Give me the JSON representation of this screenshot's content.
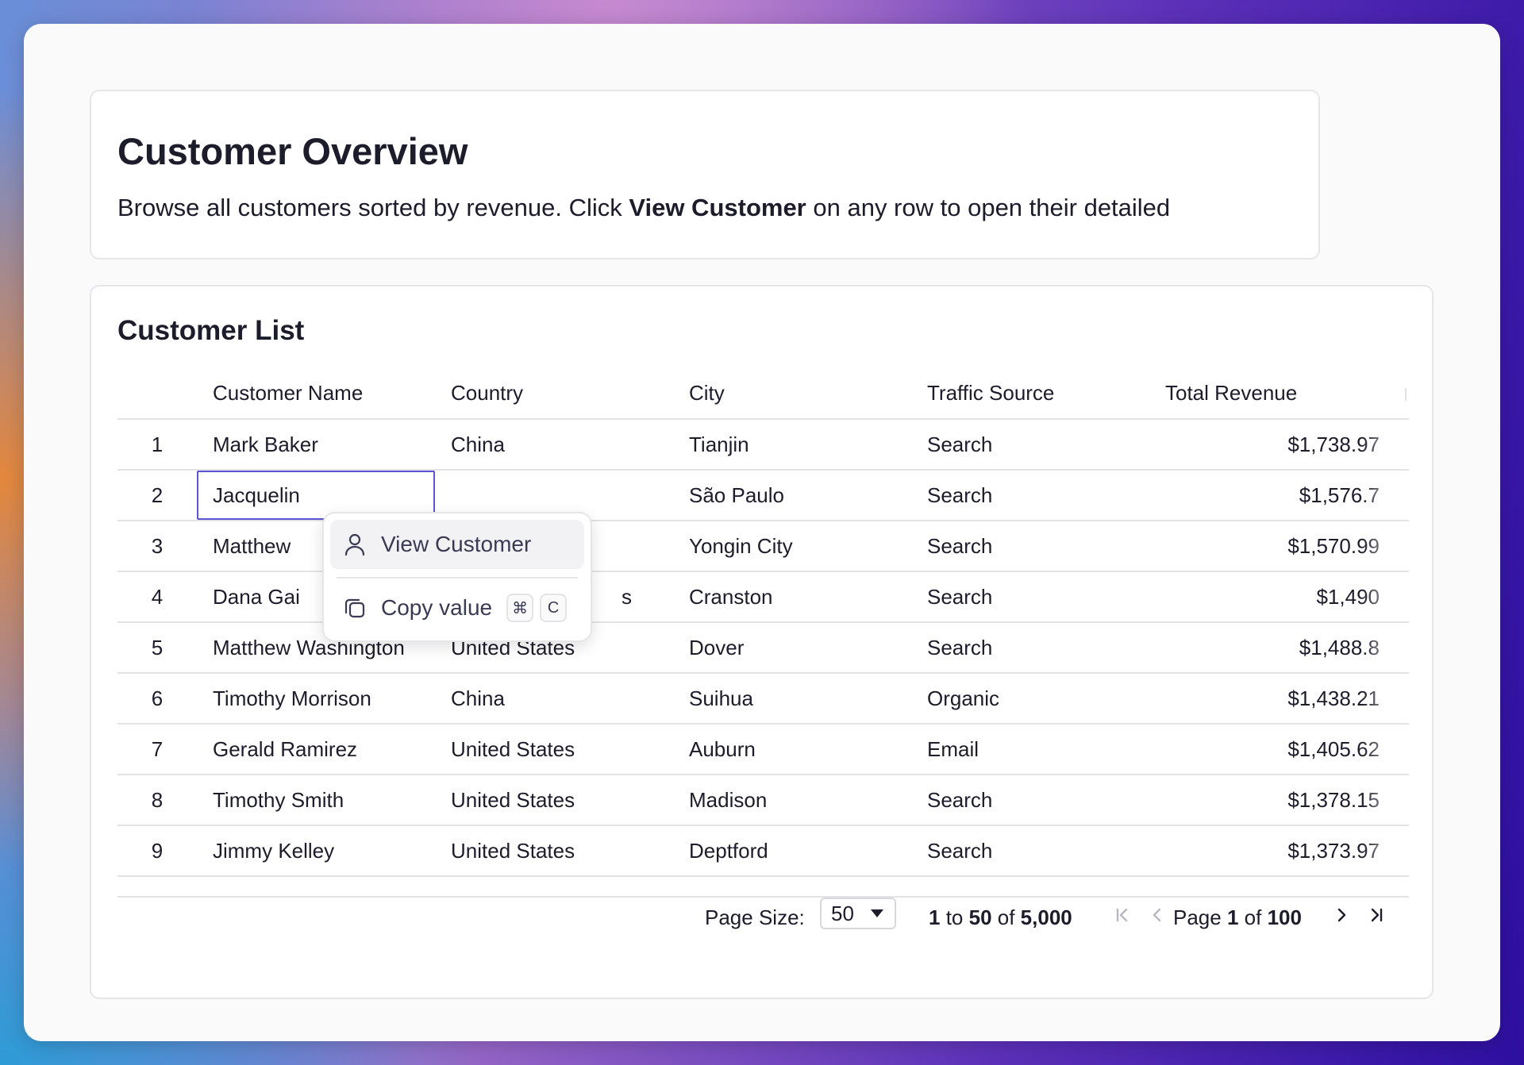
{
  "overview": {
    "title": "Customer Overview",
    "desc_before": "Browse all customers sorted by revenue. Click ",
    "desc_bold": "View Customer",
    "desc_after": " on any row to open their detailed"
  },
  "list": {
    "title": "Customer List",
    "columns": [
      "Customer Name",
      "Country",
      "City",
      "Traffic Source",
      "Total Revenue"
    ],
    "rows": [
      {
        "idx": "1",
        "name": "Mark Baker",
        "country": "China",
        "city": "Tianjin",
        "source": "Search",
        "revenue": "$1,738.97"
      },
      {
        "idx": "2",
        "name": "Jacquelin",
        "country": "",
        "city": "São Paulo",
        "source": "Search",
        "revenue": "$1,576.7"
      },
      {
        "idx": "3",
        "name": "Matthew",
        "country": "",
        "city": "Yongin City",
        "source": "Search",
        "revenue": "$1,570.99"
      },
      {
        "idx": "4",
        "name": "Dana Gai",
        "country": "s",
        "city": "Cranston",
        "source": "Search",
        "revenue": "$1,490"
      },
      {
        "idx": "5",
        "name": "Matthew Washington",
        "country": "United States",
        "city": "Dover",
        "source": "Search",
        "revenue": "$1,488.8"
      },
      {
        "idx": "6",
        "name": "Timothy Morrison",
        "country": "China",
        "city": "Suihua",
        "source": "Organic",
        "revenue": "$1,438.21"
      },
      {
        "idx": "7",
        "name": "Gerald Ramirez",
        "country": "United States",
        "city": "Auburn",
        "source": "Email",
        "revenue": "$1,405.62"
      },
      {
        "idx": "8",
        "name": "Timothy Smith",
        "country": "United States",
        "city": "Madison",
        "source": "Search",
        "revenue": "$1,378.15"
      },
      {
        "idx": "9",
        "name": "Jimmy Kelley",
        "country": "United States",
        "city": "Deptford",
        "source": "Search",
        "revenue": "$1,373.97"
      }
    ]
  },
  "pager": {
    "page_size_label": "Page Size:",
    "page_size_value": "50",
    "range_from": "1",
    "range_to_word": " to ",
    "range_to": "50",
    "range_of_word": " of ",
    "range_total": "5,000",
    "page_word": "Page ",
    "page_current": "1",
    "page_of_word": " of ",
    "page_total": "100"
  },
  "context_menu": {
    "view_label": "View Customer",
    "view_icon": "user-icon",
    "copy_label": "Copy value",
    "copy_icon": "copy-icon",
    "shortcut_mod": "⌘",
    "shortcut_key": "C"
  },
  "colors": {
    "accent": "#5b55d6",
    "text": "#1c1c2b",
    "border": "#e3e3e6"
  }
}
